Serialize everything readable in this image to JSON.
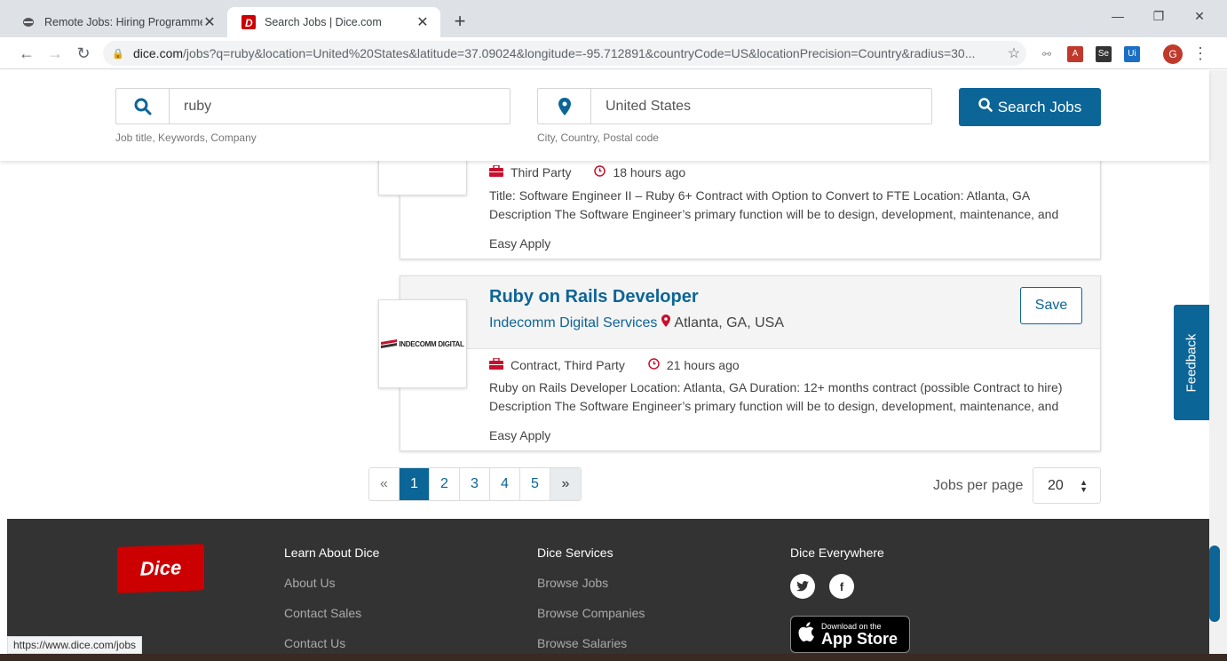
{
  "browser": {
    "tabs": [
      {
        "title": "Remote Jobs: Hiring Programme",
        "icon": "remote-icon"
      },
      {
        "title": "Search Jobs | Dice.com",
        "icon": "dice-favicon"
      }
    ],
    "new_tab": "+",
    "url_host": "dice.com",
    "url_rest": "/jobs?q=ruby&location=United%20States&latitude=37.09024&longitude=-95.712891&countryCode=US&locationPrecision=Country&radius=30...",
    "profile_initial": "G",
    "status_url": "https://www.dice.com/jobs"
  },
  "search": {
    "keyword_value": "ruby",
    "keyword_hint": "Job title, Keywords, Company",
    "location_value": "United States",
    "location_hint": "City, Country, Postal code",
    "button_label": "Search Jobs"
  },
  "jobs": [
    {
      "employment_type": "Third Party",
      "posted": "18 hours ago",
      "description_1": "Title: Software Engineer II – Ruby 6+ Contract with Option to Convert to FTE Location: Atlanta, GA",
      "description_2": "Description The Software Engineer’s primary function will be to design, development, maintenance, and",
      "apply": "Easy Apply"
    },
    {
      "title": "Ruby on Rails Developer",
      "company": "Indecomm Digital Services",
      "location": "Atlanta, GA, USA",
      "logo_text": "INDECOMM DIGITAL",
      "save_label": "Save",
      "employment_type": "Contract, Third Party",
      "posted": "21 hours ago",
      "description_1": "Ruby on Rails Developer Location: Atlanta, GA Duration: 12+ months contract (possible Contract to hire)",
      "description_2": "Description The Software Engineer’s primary function will be to design, development, maintenance, and",
      "apply": "Easy Apply"
    }
  ],
  "pagination": {
    "prev": "«",
    "pages": [
      "1",
      "2",
      "3",
      "4",
      "5"
    ],
    "current": "1",
    "next": "»",
    "per_page_label": "Jobs per page",
    "per_page_value": "20"
  },
  "feedback_label": "Feedback",
  "footer": {
    "logo_text": "Dice",
    "col1": {
      "heading": "Learn About Dice",
      "links": [
        "About Us",
        "Contact Sales",
        "Contact Us"
      ]
    },
    "col2": {
      "heading": "Dice Services",
      "links": [
        "Browse Jobs",
        "Browse Companies",
        "Browse Salaries"
      ]
    },
    "col3": {
      "heading": "Dice Everywhere",
      "appstore_small": "Download on the",
      "appstore_big": "App Store"
    }
  },
  "colors": {
    "brand_blue": "#0c6597",
    "dice_red": "#cc0000",
    "footer_bg": "#333333"
  }
}
